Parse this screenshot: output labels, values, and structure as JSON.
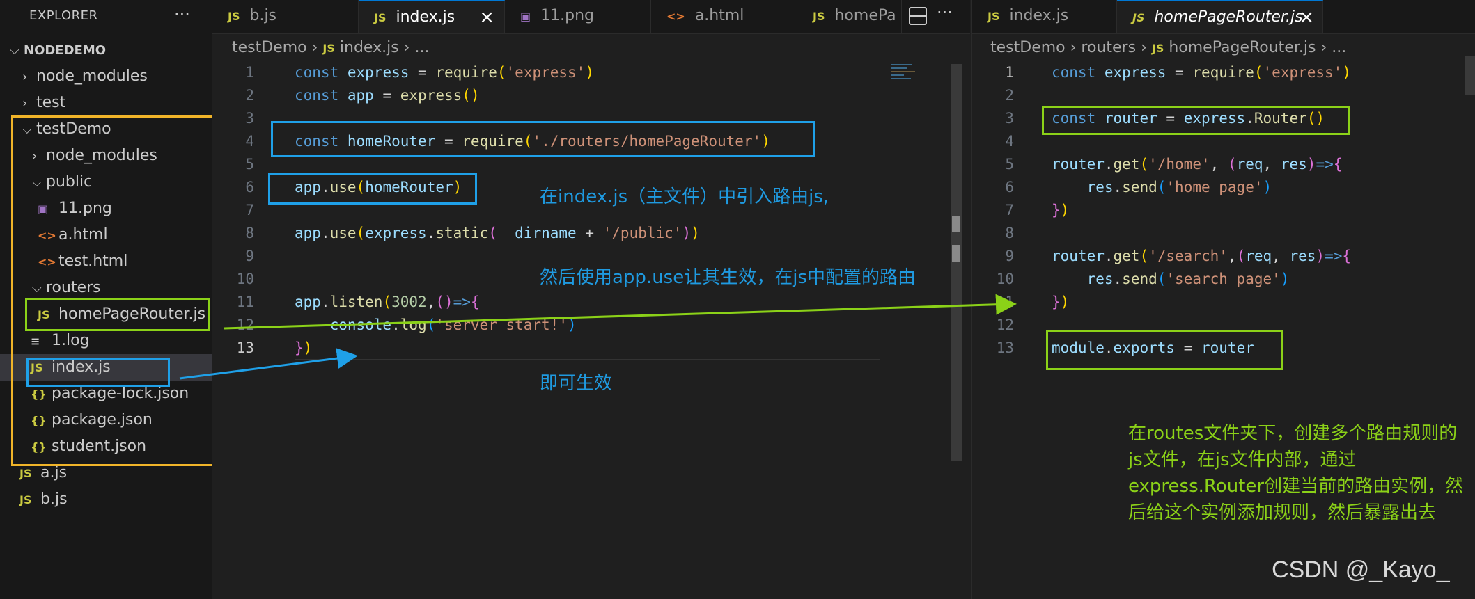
{
  "explorer": {
    "title": "EXPLORER",
    "more_icon": "ellipsis-icon",
    "tree": [
      {
        "label": "NODEDEMO",
        "type": "root",
        "chevron": "down"
      },
      {
        "label": "node_modules",
        "type": "folder",
        "chevron": "right"
      },
      {
        "label": "test",
        "type": "folder",
        "chevron": "right"
      },
      {
        "label": "testDemo",
        "type": "folder",
        "chevron": "down"
      },
      {
        "label": "node_modules",
        "type": "folder",
        "chevron": "right"
      },
      {
        "label": "public",
        "type": "folder",
        "chevron": "down"
      },
      {
        "label": "11.png",
        "type": "image"
      },
      {
        "label": "a.html",
        "type": "html"
      },
      {
        "label": "test.html",
        "type": "html"
      },
      {
        "label": "routers",
        "type": "folder",
        "chevron": "down"
      },
      {
        "label": "homePageRouter.js",
        "type": "js"
      },
      {
        "label": "1.log",
        "type": "log"
      },
      {
        "label": "index.js",
        "type": "js",
        "selected": true
      },
      {
        "label": "package-lock.json",
        "type": "json"
      },
      {
        "label": "package.json",
        "type": "json"
      },
      {
        "label": "student.json",
        "type": "json"
      },
      {
        "label": "a.js",
        "type": "js"
      },
      {
        "label": "b.js",
        "type": "js"
      }
    ],
    "icon_labels": {
      "js": "JS",
      "html": "<>",
      "json": "{}",
      "image": "▣",
      "log": "≡"
    }
  },
  "left_editor": {
    "tabs": [
      {
        "label": "b.js",
        "icon": "JS"
      },
      {
        "label": "index.js",
        "icon": "JS",
        "active": true,
        "close": "×"
      },
      {
        "label": "11.png",
        "icon": "▣"
      },
      {
        "label": "a.html",
        "icon": "<>"
      },
      {
        "label": "homePa",
        "icon": "JS"
      }
    ],
    "split_icon": "split-editor-icon",
    "more": "···",
    "breadcrumb": {
      "folder": "testDemo",
      "file": "index.js",
      "tail": "..."
    },
    "line_numbers": [
      "1",
      "2",
      "3",
      "4",
      "5",
      "6",
      "7",
      "8",
      "9",
      "10",
      "11",
      "12",
      "13"
    ],
    "current_line": "13"
  },
  "right_editor": {
    "tabs": [
      {
        "label": "index.js",
        "icon": "JS"
      },
      {
        "label": "homePageRouter.js",
        "icon": "JS",
        "active": true,
        "close": "×"
      }
    ],
    "breadcrumb": {
      "folder": "testDemo",
      "sub": "routers",
      "file": "homePageRouter.js",
      "tail": "..."
    },
    "line_numbers": [
      "1",
      "2",
      "3",
      "4",
      "5",
      "6",
      "7",
      "8",
      "9",
      "10",
      "11",
      "12",
      "13"
    ],
    "current_line": "1"
  },
  "annotations": {
    "blue_1": "在index.js（主文件）中引入路由js,",
    "blue_2": "然后使用app.use让其生效，在js中配置的路由",
    "blue_3": "即可生效",
    "green": "在routes文件夹下，创建多个路由规则的js文件，在js文件内部，通过express.Router创建当前的路由实例，然后给这个实例添加规则，然后暴露出去"
  },
  "watermark": "CSDN @_Kayo_",
  "colors": {
    "annotation_blue": "#1fa0e8",
    "annotation_green": "#8bd118",
    "annotation_yellow": "#f0b429",
    "accent": "#0078d4"
  }
}
